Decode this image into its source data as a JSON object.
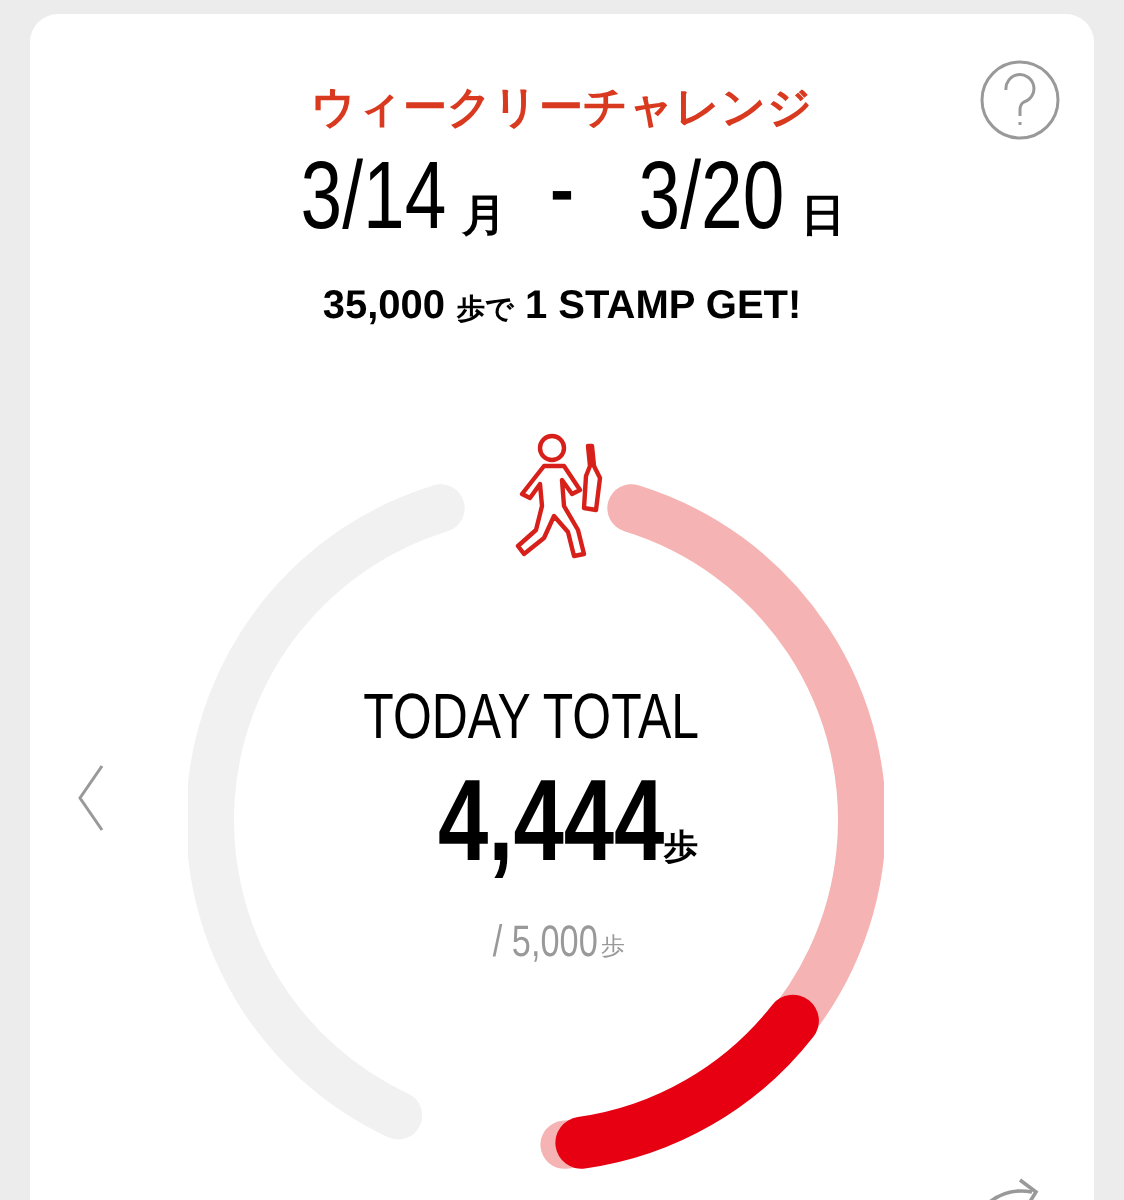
{
  "challenge": {
    "title": "ウィークリーチャレンジ",
    "start_date": "3/14",
    "start_day": "月",
    "separator": "-",
    "end_date": "3/20",
    "end_day": "日",
    "goal_text": "35,000",
    "goal_unit": "歩で",
    "goal_reward": "1 STAMP GET!"
  },
  "today": {
    "label": "TODAY TOTAL",
    "steps": "4,444",
    "unit": "歩",
    "target": "/ 5,000",
    "target_unit": "歩"
  }
}
